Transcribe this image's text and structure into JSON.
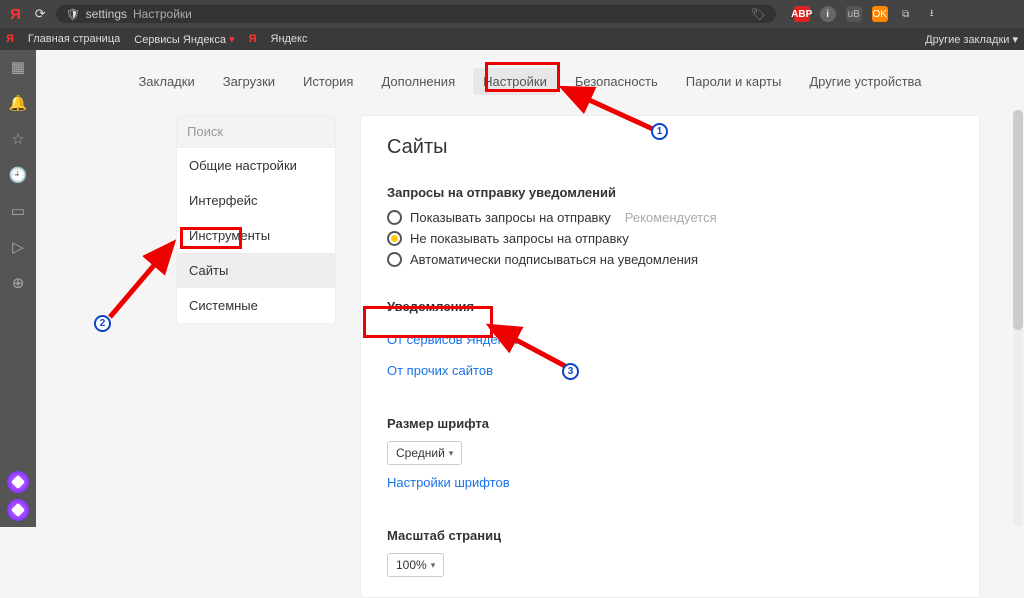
{
  "titlebar": {
    "url_key": "settings",
    "url_title": "Настройки"
  },
  "ext": {
    "abp": "ABP",
    "ub": "uB"
  },
  "bookmarks": {
    "home": "Главная страница",
    "services": "Сервисы Яндекса",
    "yandex": "Яндекс",
    "other": "Другие закладки"
  },
  "tabs": {
    "bookmarks": "Закладки",
    "downloads": "Загрузки",
    "history": "История",
    "addons": "Дополнения",
    "settings": "Настройки",
    "security": "Безопасность",
    "passwords": "Пароли и карты",
    "devices": "Другие устройства"
  },
  "sidebar": {
    "search_ph": "Поиск",
    "general": "Общие настройки",
    "interface": "Интерфейс",
    "tools": "Инструменты",
    "sites": "Сайты",
    "system": "Системные"
  },
  "main": {
    "title": "Сайты",
    "req_title": "Запросы на отправку уведомлений",
    "opt_show": "Показывать запросы на отправку",
    "opt_show_reco": "Рекомендуется",
    "opt_hide": "Не показывать запросы на отправку",
    "opt_auto": "Автоматически подписываться на уведомления",
    "notif_title": "Уведомления",
    "link_yandex": "От сервисов Яндекса",
    "link_other": "От прочих сайтов",
    "font_title": "Размер шрифта",
    "font_value": "Средний",
    "font_settings": "Настройки шрифтов",
    "zoom_title": "Масштаб страниц",
    "zoom_value": "100%"
  },
  "ann": {
    "n1": "1",
    "n2": "2",
    "n3": "3"
  }
}
